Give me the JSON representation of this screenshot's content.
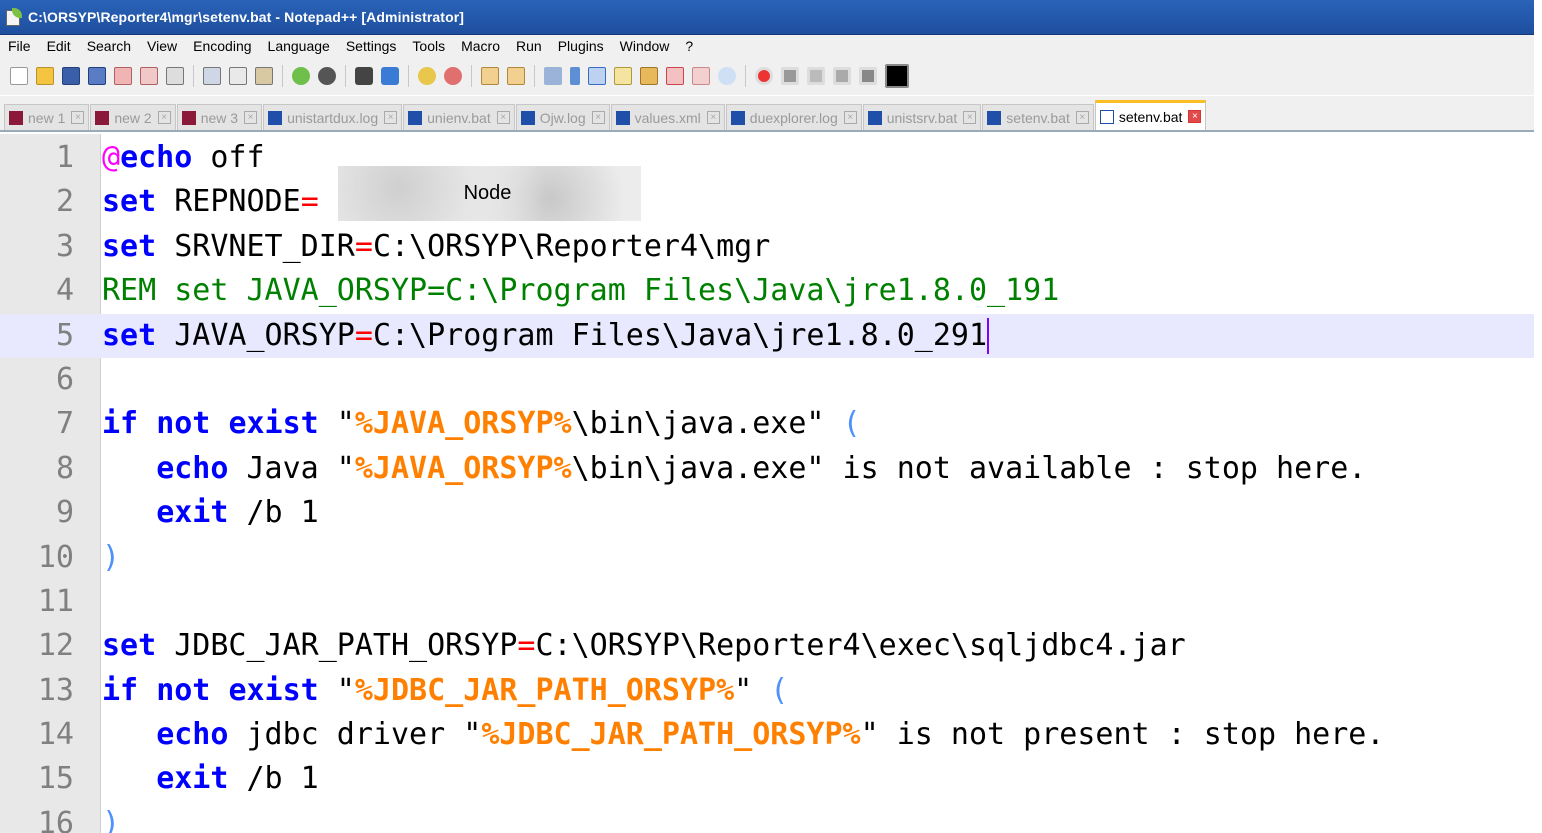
{
  "window": {
    "title": "C:\\ORSYP\\Reporter4\\mgr\\setenv.bat - Notepad++ [Administrator]"
  },
  "menu": [
    "File",
    "Edit",
    "Search",
    "View",
    "Encoding",
    "Language",
    "Settings",
    "Tools",
    "Macro",
    "Run",
    "Plugins",
    "Window",
    "?"
  ],
  "tabs": [
    {
      "label": "new 1",
      "icon_color": "#8b1a3a"
    },
    {
      "label": "new 2",
      "icon_color": "#8b1a3a"
    },
    {
      "label": "new 3",
      "icon_color": "#8b1a3a"
    },
    {
      "label": "unistartdux.log",
      "icon_color": "#1f4fa8"
    },
    {
      "label": "unienv.bat",
      "icon_color": "#1f4fa8"
    },
    {
      "label": "Ojw.log",
      "icon_color": "#1f4fa8"
    },
    {
      "label": "values.xml",
      "icon_color": "#1f4fa8"
    },
    {
      "label": "duexplorer.log",
      "icon_color": "#1f4fa8"
    },
    {
      "label": "unistsrv.bat",
      "icon_color": "#1f4fa8"
    },
    {
      "label": "setenv.bat",
      "icon_color": "#1f4fa8"
    },
    {
      "label": "setenv.bat",
      "icon_color": "#1f4fa8",
      "active": true
    }
  ],
  "editor": {
    "redaction_label": "Node",
    "lines": [
      {
        "num": "1",
        "tokens": [
          [
            "at",
            "@"
          ],
          [
            "kw",
            "echo"
          ],
          [
            "plain",
            " off"
          ]
        ]
      },
      {
        "num": "2",
        "tokens": [
          [
            "kw",
            "set"
          ],
          [
            "plain",
            " REPNODE"
          ],
          [
            "op",
            "="
          ]
        ]
      },
      {
        "num": "3",
        "tokens": [
          [
            "kw",
            "set"
          ],
          [
            "plain",
            " SRVNET_DIR"
          ],
          [
            "op",
            "="
          ],
          [
            "plain",
            "C:\\ORSYP\\Reporter4\\mgr"
          ]
        ]
      },
      {
        "num": "4",
        "tokens": [
          [
            "rem",
            "REM set JAVA_ORSYP=C:\\Program Files\\Java\\jre1.8.0_191"
          ]
        ]
      },
      {
        "num": "5",
        "tokens": [
          [
            "kw",
            "set"
          ],
          [
            "plain",
            " JAVA_ORSYP"
          ],
          [
            "op",
            "="
          ],
          [
            "plain",
            "C:\\Program Files\\Java\\jre1.8.0_291"
          ]
        ],
        "current": true
      },
      {
        "num": "6",
        "tokens": []
      },
      {
        "num": "7",
        "tokens": [
          [
            "kw",
            "if"
          ],
          [
            "plain",
            " "
          ],
          [
            "kw",
            "not"
          ],
          [
            "plain",
            " "
          ],
          [
            "kw",
            "exist"
          ],
          [
            "plain",
            " \""
          ],
          [
            "var",
            "%JAVA_ORSYP%"
          ],
          [
            "plain",
            "\\bin\\java.exe\" "
          ],
          [
            "paren",
            "("
          ]
        ]
      },
      {
        "num": "8",
        "tokens": [
          [
            "plain",
            "   "
          ],
          [
            "kw",
            "echo"
          ],
          [
            "plain",
            " Java \""
          ],
          [
            "var",
            "%JAVA_ORSYP%"
          ],
          [
            "plain",
            "\\bin\\java.exe\" is not available : stop here."
          ]
        ]
      },
      {
        "num": "9",
        "tokens": [
          [
            "plain",
            "   "
          ],
          [
            "kw",
            "exit"
          ],
          [
            "plain",
            " /b 1"
          ]
        ]
      },
      {
        "num": "10",
        "tokens": [
          [
            "paren",
            ")"
          ]
        ]
      },
      {
        "num": "11",
        "tokens": []
      },
      {
        "num": "12",
        "tokens": [
          [
            "kw",
            "set"
          ],
          [
            "plain",
            " JDBC_JAR_PATH_ORSYP"
          ],
          [
            "op",
            "="
          ],
          [
            "plain",
            "C:\\ORSYP\\Reporter4\\exec\\sqljdbc4.jar"
          ]
        ]
      },
      {
        "num": "13",
        "tokens": [
          [
            "kw",
            "if"
          ],
          [
            "plain",
            " "
          ],
          [
            "kw",
            "not"
          ],
          [
            "plain",
            " "
          ],
          [
            "kw",
            "exist"
          ],
          [
            "plain",
            " \""
          ],
          [
            "var",
            "%JDBC_JAR_PATH_ORSYP%"
          ],
          [
            "plain",
            "\" "
          ],
          [
            "paren",
            "("
          ]
        ]
      },
      {
        "num": "14",
        "tokens": [
          [
            "plain",
            "   "
          ],
          [
            "kw",
            "echo"
          ],
          [
            "plain",
            " jdbc driver \""
          ],
          [
            "var",
            "%JDBC_JAR_PATH_ORSYP%"
          ],
          [
            "plain",
            "\" is not present : stop here."
          ]
        ]
      },
      {
        "num": "15",
        "tokens": [
          [
            "plain",
            "   "
          ],
          [
            "kw",
            "exit"
          ],
          [
            "plain",
            " /b 1"
          ]
        ]
      },
      {
        "num": "16",
        "tokens": [
          [
            "paren",
            ")"
          ]
        ]
      }
    ]
  },
  "colors": {
    "keyword": "#0000ff",
    "variable": "#ff8000",
    "comment": "#008000",
    "operator": "#ff0000",
    "current_line": "#e8e8ff",
    "active_tab_accent": "#fabd23"
  }
}
